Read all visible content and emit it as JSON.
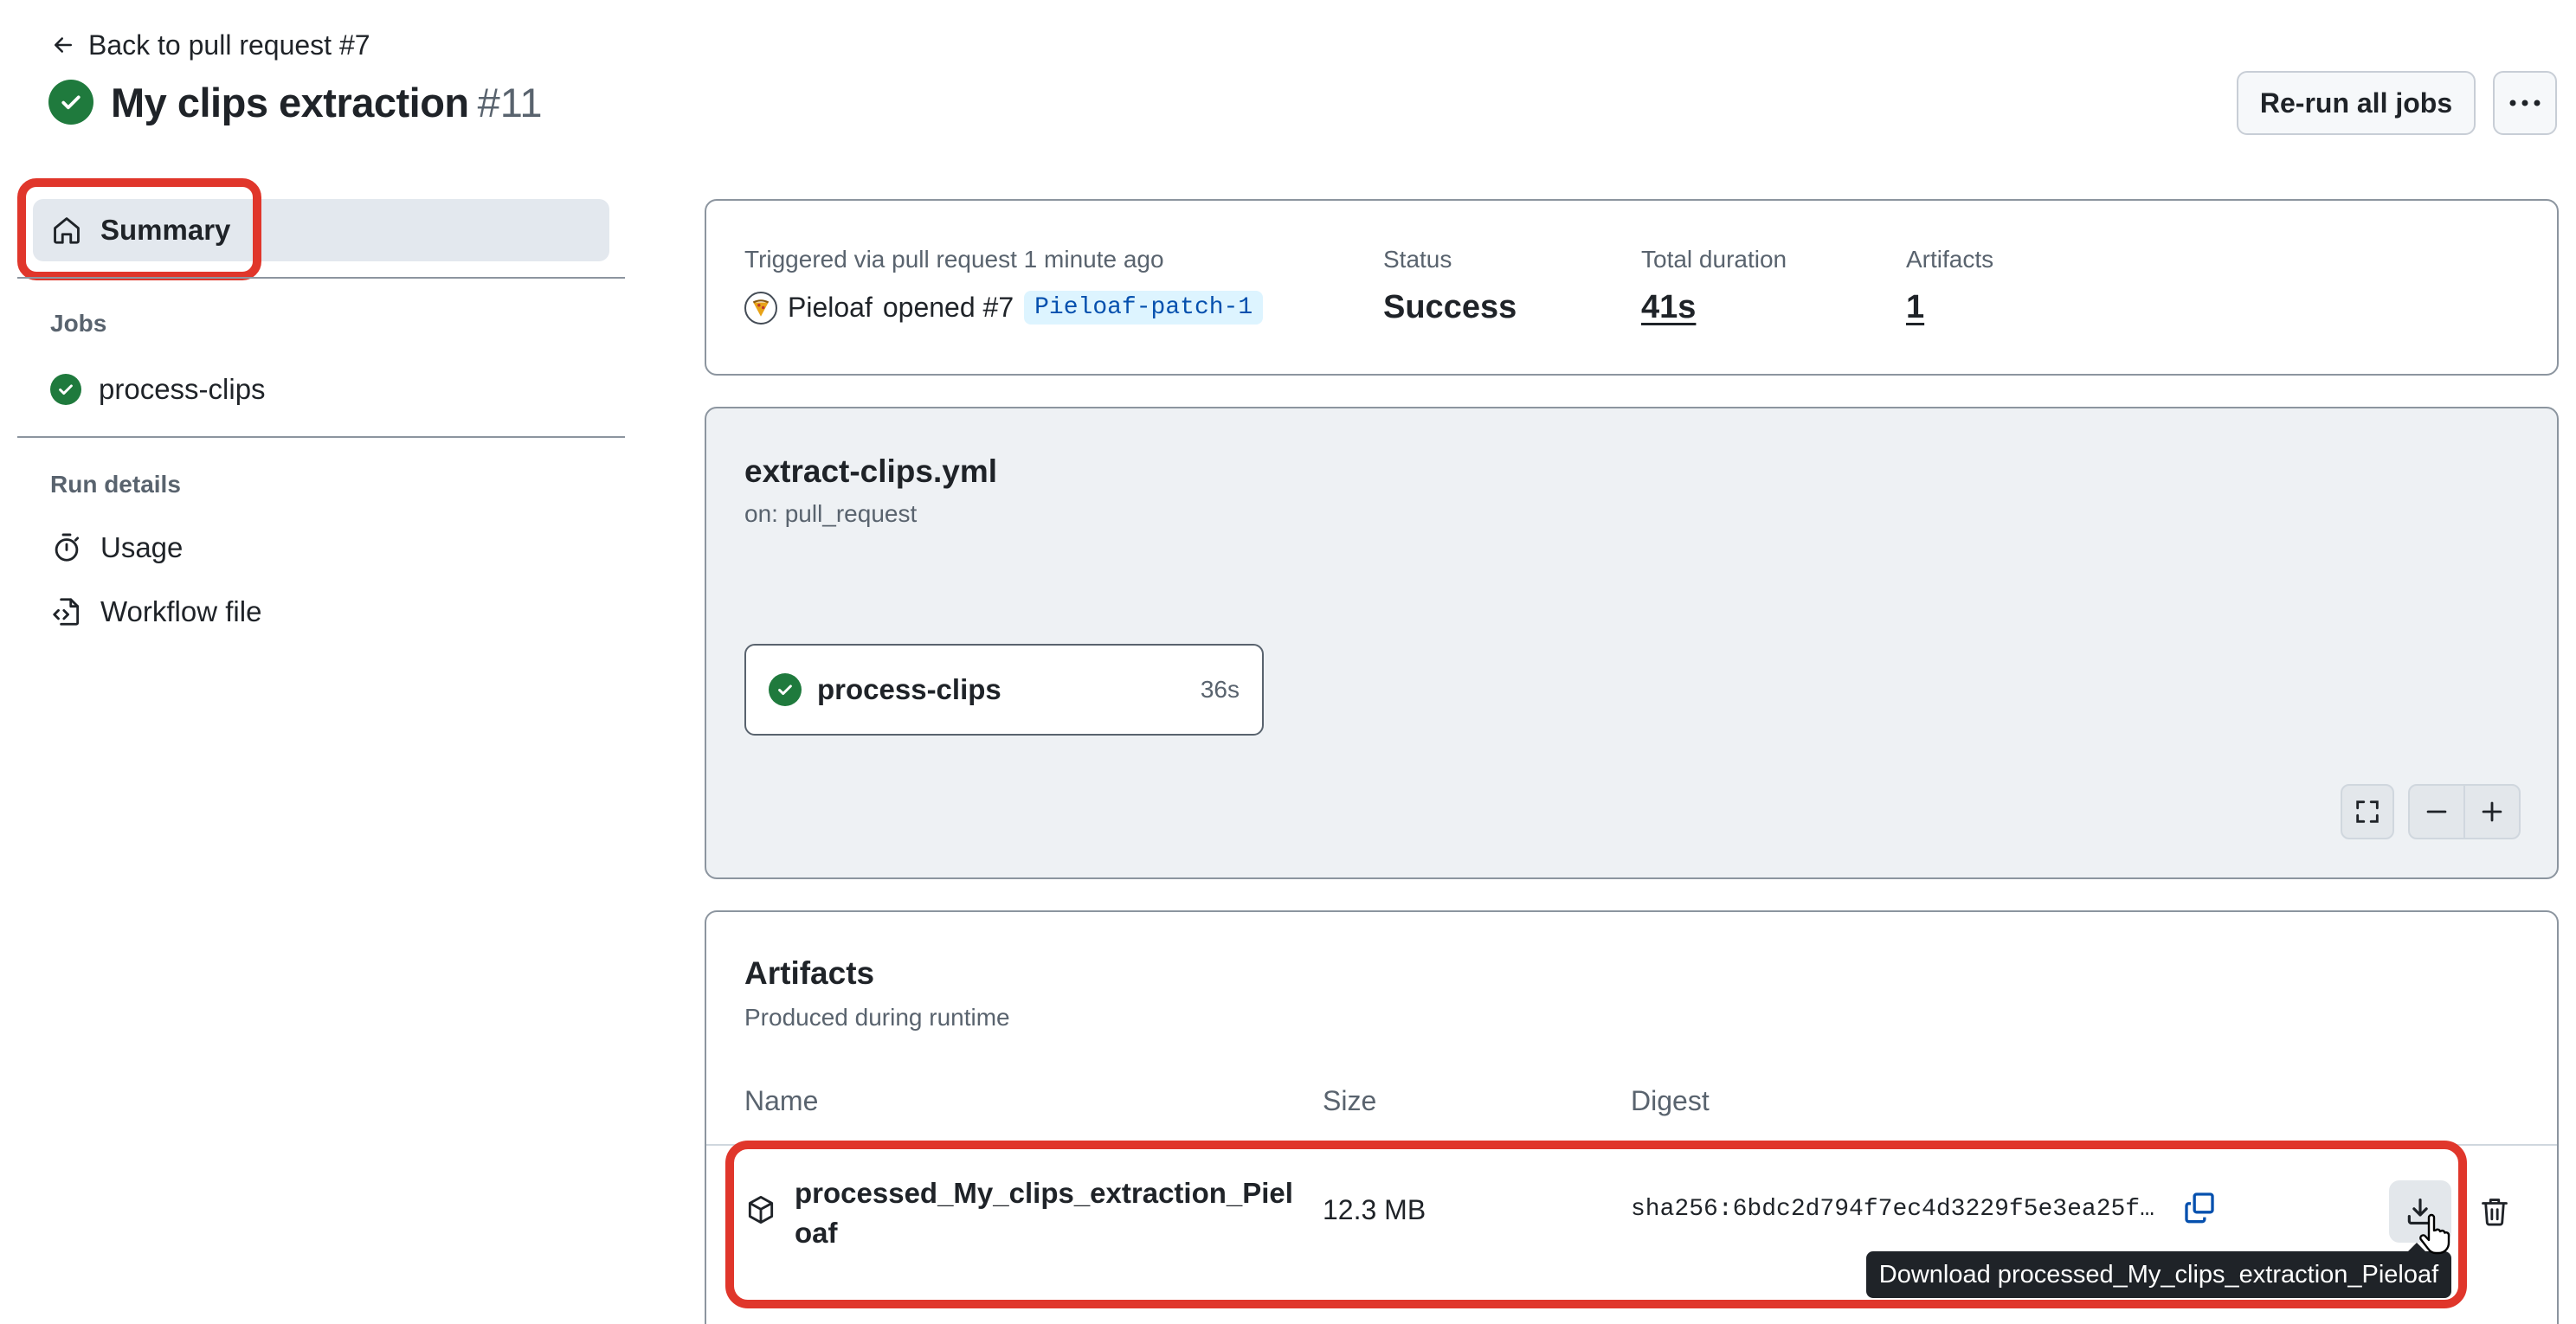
{
  "header": {
    "back_label": "Back to pull request #7",
    "title": "My clips extraction",
    "run_number": "#11",
    "rerun_label": "Re-run all jobs",
    "more_icon": "kebab-horizontal-icon"
  },
  "sidebar": {
    "summary_label": "Summary",
    "jobs_heading": "Jobs",
    "jobs": [
      {
        "label": "process-clips",
        "status": "success"
      }
    ],
    "run_details_heading": "Run details",
    "details": [
      {
        "label": "Usage",
        "icon": "stopwatch-icon"
      },
      {
        "label": "Workflow file",
        "icon": "file-code-icon"
      }
    ]
  },
  "trigger": {
    "label": "Triggered via pull request 1 minute ago",
    "actor": "Pieloaf",
    "action": "opened #7",
    "branch": "Pieloaf-patch-1",
    "status_label": "Status",
    "status_value": "Success",
    "duration_label": "Total duration",
    "duration_value": "41s",
    "artifacts_label": "Artifacts",
    "artifacts_value": "1"
  },
  "workflow": {
    "file": "extract-clips.yml",
    "event": "on: pull_request",
    "job": {
      "name": "process-clips",
      "duration": "36s"
    }
  },
  "artifacts": {
    "title": "Artifacts",
    "subtitle": "Produced during runtime",
    "columns": [
      "Name",
      "Size",
      "Digest"
    ],
    "rows": [
      {
        "name": "processed_My_clips_extraction_Pieloaf",
        "size": "12.3 MB",
        "digest": "sha256:6bdc2d794f7ec4d3229f5e3ea25f…"
      }
    ],
    "tooltip": "Download processed_My_clips_extraction_Pieloaf"
  },
  "colors": {
    "success": "#1f7a3d",
    "highlight": "#e0362b",
    "link": "#0550ae"
  }
}
